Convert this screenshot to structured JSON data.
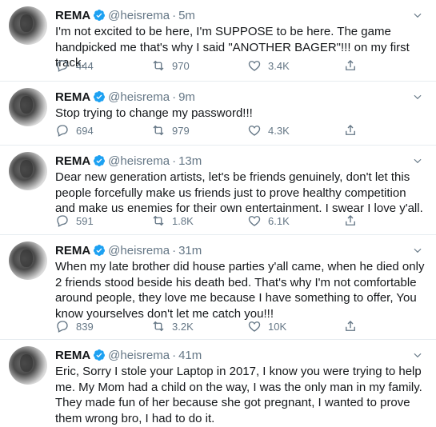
{
  "tweets": [
    {
      "name": "REMA",
      "handle": "@heisrema",
      "separator": "·",
      "time": "5m",
      "text": "I'm not excited to be here, I'm SUPPOSE to be here. The game handpicked me that's why I said \"ANOTHER BAGER\"!!! on my first track.",
      "replies": "444",
      "retweets": "970",
      "likes": "3.4K"
    },
    {
      "name": "REMA",
      "handle": "@heisrema",
      "separator": "·",
      "time": "9m",
      "text": "Stop trying to change my password!!!",
      "replies": "694",
      "retweets": "979",
      "likes": "4.3K"
    },
    {
      "name": "REMA",
      "handle": "@heisrema",
      "separator": "·",
      "time": "13m",
      "text": "Dear new generation artists, let's be friends genuinely, don't let this people forcefully make us friends just to prove healthy competition and make us enemies for their own entertainment. I swear I love y'all.",
      "replies": "591",
      "retweets": "1.8K",
      "likes": "6.1K"
    },
    {
      "name": "REMA",
      "handle": "@heisrema",
      "separator": "·",
      "time": "31m",
      "text": "When my late brother did house parties y'all came, when he died only 2 friends stood beside his death bed. That's why I'm not comfortable around people, they love me because I have something to offer, You know yourselves don't let me catch you!!!",
      "replies": "839",
      "retweets": "3.2K",
      "likes": "10K"
    },
    {
      "name": "REMA",
      "handle": "@heisrema",
      "separator": "·",
      "time": "41m",
      "text": "Eric, Sorry I stole your Laptop in 2017, I know you were trying to help me. My Mom had a child on the way, I was the only man in my family. They made fun of her because she got pregnant, I wanted to prove them wrong bro, I had to do it.",
      "replies": "",
      "retweets": "",
      "likes": ""
    }
  ],
  "icons": {
    "verified": "verified-badge-icon",
    "caret": "chevron-down-icon",
    "reply": "reply-icon",
    "retweet": "retweet-icon",
    "like": "heart-icon",
    "share": "share-icon"
  },
  "colors": {
    "text": "#14171a",
    "secondary": "#657786",
    "verified": "#1da1f2",
    "divider": "#e6ecf0"
  }
}
